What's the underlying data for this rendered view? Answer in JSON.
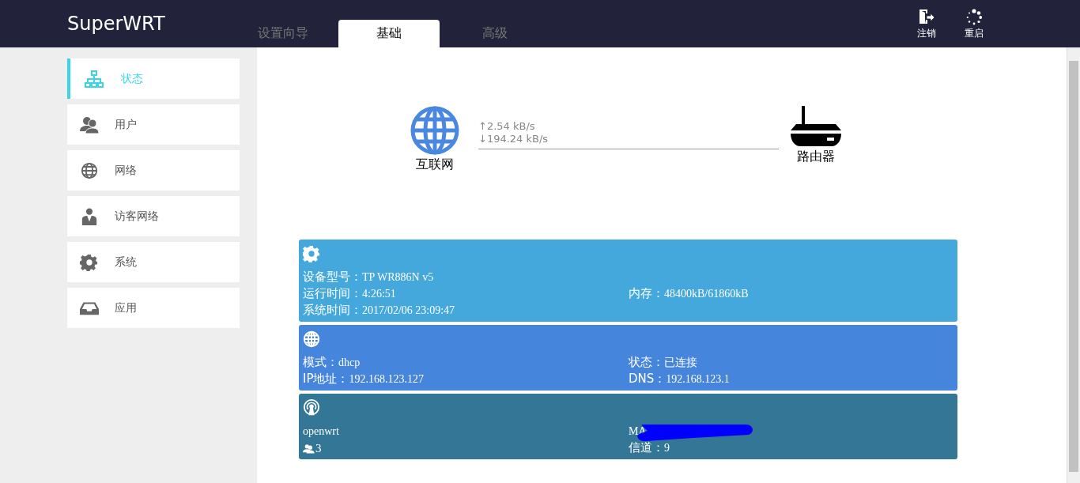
{
  "header": {
    "logo": "SuperWRT",
    "tabs": [
      {
        "label": "设置向导",
        "selected": false
      },
      {
        "label": "基础",
        "selected": true
      },
      {
        "label": "高级",
        "selected": false
      }
    ],
    "actions": [
      {
        "kind": "logout",
        "label": "注销"
      },
      {
        "kind": "restart",
        "label": "重启"
      }
    ]
  },
  "sidebar": {
    "items": [
      {
        "kind": "sitemap",
        "label": "状态",
        "selected": true
      },
      {
        "kind": "users",
        "label": "用户",
        "selected": false
      },
      {
        "kind": "globe",
        "label": "网络",
        "selected": false
      },
      {
        "kind": "guest",
        "label": "访客网络",
        "selected": false
      },
      {
        "kind": "gear",
        "label": "系统",
        "selected": false
      },
      {
        "kind": "tray",
        "label": "应用",
        "selected": false
      }
    ]
  },
  "topology": {
    "internet": "互联网",
    "upload": "↑2.54 kB/s",
    "download": "↓194.24 kB/s",
    "router": "路由器"
  },
  "cards": [
    {
      "kind": "system",
      "color": "#44a8dc",
      "rows": [
        {
          "left": {
            "label": "设备型号：",
            "value": "TP WR886N v5"
          }
        },
        {
          "left": {
            "label": "运行时间：",
            "value": "4:26:51"
          },
          "right": {
            "label": "内存：",
            "value": "48400kB/61860kB"
          }
        },
        {
          "left": {
            "label": "系统时间：",
            "value": "2017/02/06 23:09:47"
          }
        }
      ]
    },
    {
      "kind": "network",
      "color": "#4585db",
      "rows": [
        {
          "left": {
            "label": "模式：",
            "value": "dhcp"
          },
          "right": {
            "label": "状态：",
            "value": "已连接"
          }
        },
        {
          "left": {
            "label": "IP地址：",
            "value": "192.168.123.127"
          },
          "right": {
            "label": "DNS：",
            "value": "192.168.123.1"
          }
        }
      ]
    },
    {
      "kind": "wireless",
      "color": "#337696",
      "rows": [
        {
          "left": {
            "value": "openwrt"
          },
          "right": {
            "kind": "redacted",
            "label": "MA"
          }
        },
        {
          "left": {
            "kind": "clients",
            "value": "3"
          },
          "right": {
            "label": "信道：",
            "value": "9"
          }
        }
      ]
    }
  ]
}
